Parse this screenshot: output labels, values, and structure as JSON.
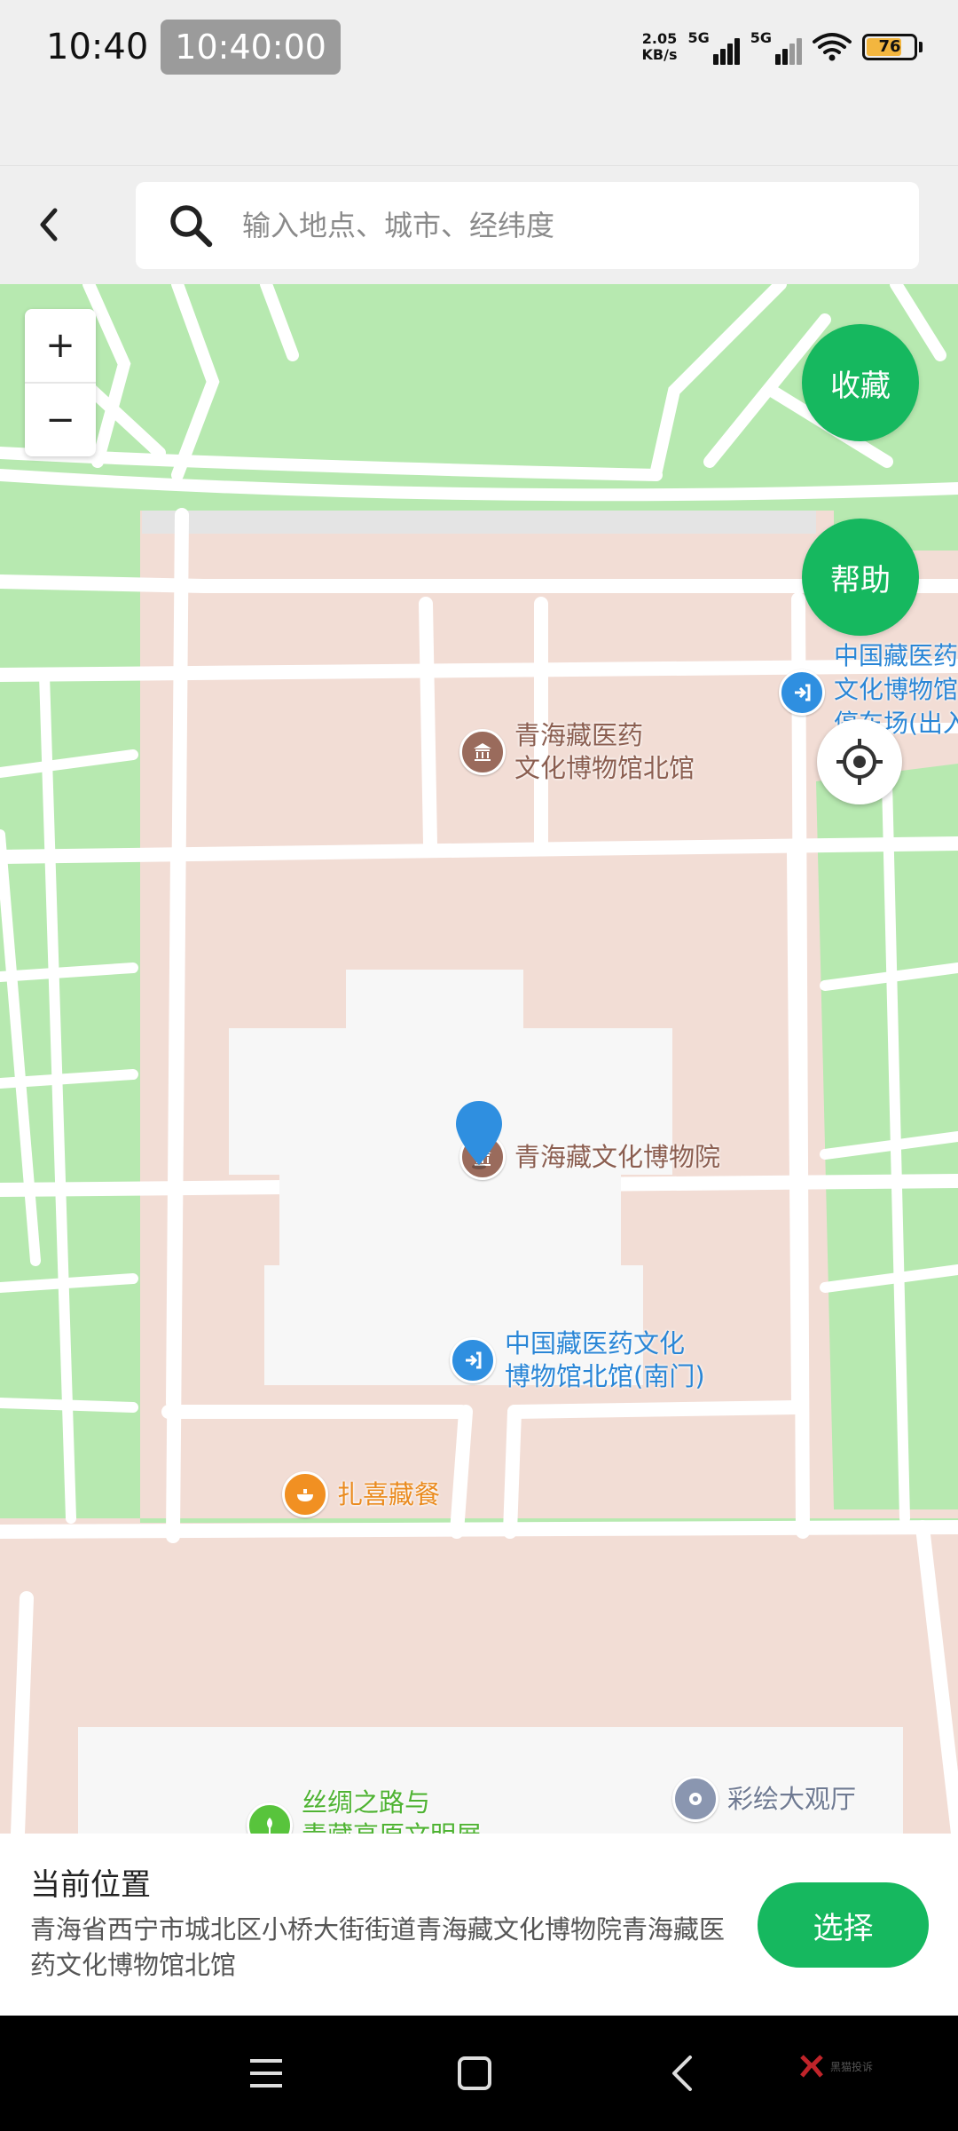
{
  "status_bar": {
    "time": "10:40",
    "time_chip": "10:40:00",
    "net_speed_value": "2.05",
    "net_speed_unit": "KB/s",
    "signal_1_label": "5G",
    "signal_2_label": "5G",
    "battery": "76",
    "battery_level": 0.76,
    "battery_color": "#f3b63f"
  },
  "header": {
    "back_icon": "chevron-left-icon",
    "search_icon": "search-icon",
    "search_placeholder": "输入地点、城市、经纬度"
  },
  "map": {
    "zoom_in": "+",
    "zoom_out": "−",
    "favorite_button": "收藏",
    "help_button": "帮助",
    "locate_icon": "crosshair-icon",
    "pois": [
      {
        "icon": "museum-icon",
        "lines": [
          "青海藏医药",
          "文化博物馆北馆"
        ]
      },
      {
        "icon": "entrance-icon",
        "lines": [
          "中国藏医药",
          "文化博物馆",
          "停车场(出入"
        ]
      },
      {
        "icon": "museum-icon",
        "lines": [
          "青海藏文化博物院"
        ]
      },
      {
        "icon": "entrance-icon",
        "lines": [
          "中国藏医药文化",
          "博物馆北馆(南门)"
        ]
      },
      {
        "icon": "restaurant-icon",
        "lines": [
          "扎喜藏餐"
        ]
      },
      {
        "icon": "park-icon",
        "lines": [
          "丝绸之路与",
          "青藏高原文明展"
        ]
      },
      {
        "icon": "hall-icon",
        "lines": [
          "彩绘大观厅"
        ]
      }
    ],
    "colors": {
      "green": "#b7e9b0",
      "block": "#f2ddd5",
      "building": "#f7f7f7",
      "road": "#ffffff",
      "accent": "#16b85f",
      "pin": "#2f8fe0"
    }
  },
  "panel": {
    "title": "当前位置",
    "address": "青海省西宁市城北区小桥大街街道青海藏文化博物院青海藏医药文化博物馆北馆",
    "select_button": "选择"
  },
  "nav_bar": {
    "menu_icon": "menu-icon",
    "home_icon": "home-icon",
    "back_icon": "back-icon",
    "watermark": "黑猫投诉"
  }
}
